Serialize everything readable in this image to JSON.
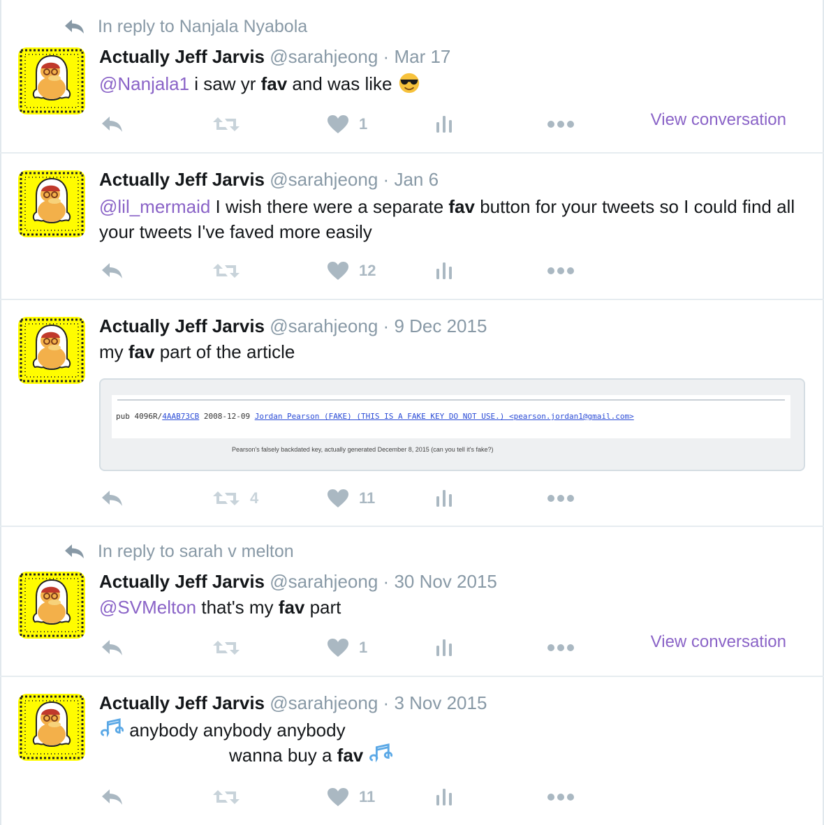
{
  "colors": {
    "mention": "#8a63c7",
    "muted": "#8899a6",
    "action_gray": "#aab8c2",
    "avatar_yellow": "#fffc00"
  },
  "tweets": [
    {
      "context": "In reply to Nanjala Nyabola",
      "name": "Actually Jeff Jarvis",
      "handle": "@sarahjeong",
      "sep": "·",
      "time": "Mar 17",
      "mention": "@Nanjala1",
      "text_a": " i saw yr ",
      "kw": "fav",
      "text_b": " and was like",
      "emoji": "smiling-face-with-sunglasses",
      "retweets": "",
      "likes": "1",
      "view_conversation": "View conversation"
    },
    {
      "name": "Actually Jeff Jarvis",
      "handle": "@sarahjeong",
      "sep": "·",
      "time": "Jan 6",
      "mention": "@lil_mermaid",
      "text_a": " I wish there were a separate ",
      "kw": "fav",
      "text_b": " button for your tweets so I could find all your tweets I've faved more easily",
      "retweets": "",
      "likes": "12"
    },
    {
      "name": "Actually Jeff Jarvis",
      "handle": "@sarahjeong",
      "sep": "·",
      "time": "9 Dec 2015",
      "text_a": "my ",
      "kw": "fav",
      "text_b": " part of the article",
      "card": {
        "pub": "pub  4096R/",
        "keyid": "4AAB73CB",
        "date": " 2008-12-09 ",
        "uid": "Jordan Pearson (FAKE) (THIS IS A FAKE KEY DO NOT USE.) <pearson.jordan1@gmail.com>",
        "caption": "Pearson's falsely backdated key, actually generated December 8, 2015 (can you tell it's fake?)"
      },
      "retweets": "4",
      "likes": "11"
    },
    {
      "context": "In reply to sarah v melton",
      "name": "Actually Jeff Jarvis",
      "handle": "@sarahjeong",
      "sep": "·",
      "time": "30 Nov 2015",
      "mention": "@SVMelton",
      "text_a": " that's my ",
      "kw": "fav",
      "text_b": " part",
      "retweets": "",
      "likes": "1",
      "view_conversation": "View conversation"
    },
    {
      "name": "Actually Jeff Jarvis",
      "handle": "@sarahjeong",
      "sep": "·",
      "time": "3 Nov 2015",
      "emoji": "multiple-musical-notes",
      "line1": " anybody anybody anybody",
      "line2_a": "wanna buy a ",
      "kw": "fav",
      "retweets": "",
      "likes": "11"
    }
  ]
}
